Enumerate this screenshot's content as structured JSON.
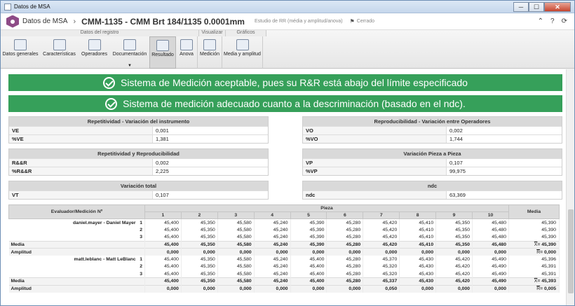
{
  "window": {
    "title": "Datos de MSA",
    "min": "─",
    "max": "☐",
    "close": "✕"
  },
  "header": {
    "module": "Datos de MSA",
    "separator": "›",
    "title": "CMM-1135 - CMM Brt 184/1135 0.0001mm",
    "study": "Estudio de RR (média y amplitud/anova)",
    "status": "Cerrado",
    "flag_glyph": "⚑",
    "icons": [
      "collapse-icon",
      "help-icon",
      "refresh-icon"
    ],
    "icon_glyphs": [
      "⌃",
      "?",
      "⟳"
    ]
  },
  "toolbar": {
    "groups": [
      {
        "label": "Datos del registro",
        "width": 283
      },
      {
        "label": "Visualizar",
        "width": 38
      },
      {
        "label": "Gráficos",
        "width": 58
      }
    ],
    "items": [
      {
        "label": "Datos generales",
        "icon": "window-icon",
        "width": 56
      },
      {
        "label": "Características",
        "icon": "chart-line-icon",
        "width": 55
      },
      {
        "label": "Operadores",
        "icon": "users-icon",
        "width": 45
      },
      {
        "label": "Documentación",
        "icon": "folder-icon",
        "width": 56
      },
      {
        "label": "Resultado",
        "icon": "clipboard-icon",
        "width": 38,
        "active": true
      },
      {
        "label": "Anova",
        "icon": "sigma-icon",
        "width": 31
      },
      {
        "label": "Medición",
        "icon": "measure-icon",
        "width": 35
      },
      {
        "label": "Media y amplitud",
        "icon": "chart-icon",
        "width": 58
      }
    ]
  },
  "banners": [
    "Sistema de Medición aceptable, pues su R&R está abajo del límite especificado",
    "Sistema de medición adecuado cuanto a la descriminación (basado en el ndc)."
  ],
  "boxes": [
    {
      "title": "Repetitividad - Variación del instrumento",
      "rows": [
        {
          "label": "VE",
          "value": "0,001"
        },
        {
          "label": "%VE",
          "value": "1,381"
        }
      ]
    },
    {
      "title": "Reproducibilidad - Variación entre Operadores",
      "rows": [
        {
          "label": "VO",
          "value": "0,002"
        },
        {
          "label": "%VO",
          "value": "1,744"
        }
      ]
    },
    {
      "title": "Repetitividad y Reproducibilidad",
      "rows": [
        {
          "label": "R&&R",
          "value": "0,002"
        },
        {
          "label": "%R&&R",
          "value": "2,225"
        }
      ]
    },
    {
      "title": "Variación Pieza a Pieza",
      "rows": [
        {
          "label": "VP",
          "value": "0,107"
        },
        {
          "label": "%VP",
          "value": "99,975"
        }
      ]
    },
    {
      "title": "Variación total",
      "rows": [
        {
          "label": "VT",
          "value": "0,107"
        }
      ]
    },
    {
      "title": "ndc",
      "rows": [
        {
          "label": "ndc",
          "value": "63,369"
        }
      ]
    }
  ],
  "table": {
    "evaluator_header": "Evaluador/Medición Nº",
    "piece_header": "Pieza",
    "media_header": "Media",
    "pieces": [
      "1",
      "2",
      "3",
      "4",
      "5",
      "6",
      "7",
      "8",
      "9",
      "10"
    ],
    "groups": [
      {
        "operator": "daniel.mayer - Daniel Mayer",
        "trials": [
          {
            "n": "1",
            "values": [
              "45,400",
              "45,350",
              "45,580",
              "45,240",
              "45,390",
              "45,280",
              "45,420",
              "45,410",
              "45,350",
              "45,480"
            ],
            "media": "45,390"
          },
          {
            "n": "2",
            "values": [
              "45,400",
              "45,350",
              "45,580",
              "45,240",
              "45,390",
              "45,280",
              "45,420",
              "45,410",
              "45,350",
              "45,480"
            ],
            "media": "45,390"
          },
          {
            "n": "3",
            "values": [
              "45,400",
              "45,350",
              "45,580",
              "45,240",
              "45,390",
              "45,280",
              "45,420",
              "45,410",
              "45,350",
              "45,480"
            ],
            "media": "45,390"
          }
        ],
        "media_label": "Media",
        "media_values": [
          "45,400",
          "45,350",
          "45,580",
          "45,240",
          "45,390",
          "45,280",
          "45,420",
          "45,410",
          "45,350",
          "45,480"
        ],
        "media_summary": {
          "symbol": "X",
          "value": "= 45,390"
        },
        "amp_label": "Amplitud",
        "amp_values": [
          "0,000",
          "0,000",
          "0,000",
          "0,000",
          "0,000",
          "0,000",
          "0,000",
          "0,000",
          "0,000",
          "0,000"
        ],
        "amp_summary": {
          "symbol": "R",
          "value": "= 0,000"
        }
      },
      {
        "operator": "matt.leblanc - Matt LeBlanc",
        "trials": [
          {
            "n": "1",
            "values": [
              "45,400",
              "45,350",
              "45,580",
              "45,240",
              "45,400",
              "45,280",
              "45,370",
              "45,430",
              "45,420",
              "45,490"
            ],
            "media": "45,396"
          },
          {
            "n": "2",
            "values": [
              "45,400",
              "45,350",
              "45,580",
              "45,240",
              "45,400",
              "45,280",
              "45,320",
              "45,430",
              "45,420",
              "45,490"
            ],
            "media": "45,391"
          },
          {
            "n": "3",
            "values": [
              "45,400",
              "45,350",
              "45,580",
              "45,240",
              "45,400",
              "45,280",
              "45,320",
              "45,430",
              "45,420",
              "45,490"
            ],
            "media": "45,391"
          }
        ],
        "media_label": "Media",
        "media_values": [
          "45,400",
          "45,350",
          "45,580",
          "45,240",
          "45,400",
          "45,280",
          "45,337",
          "45,430",
          "45,420",
          "45,490"
        ],
        "media_summary": {
          "symbol": "X",
          "value": "= 45,393"
        },
        "amp_label": "Amplitud",
        "amp_values": [
          "0,000",
          "0,000",
          "0,000",
          "0,000",
          "0,000",
          "0,000",
          "0,050",
          "0,000",
          "0,000",
          "0,000"
        ],
        "amp_summary": {
          "symbol": "R",
          "value": "= 0,005"
        }
      }
    ]
  }
}
